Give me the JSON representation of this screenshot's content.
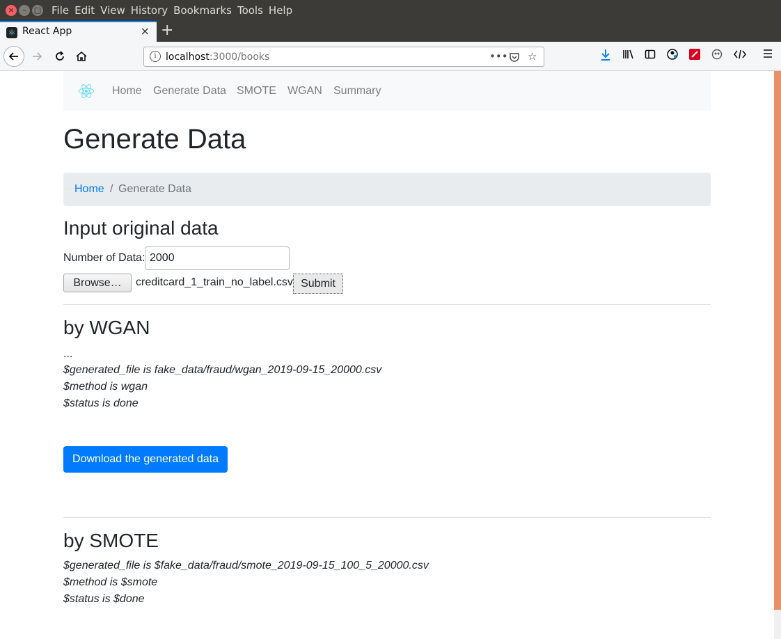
{
  "os_menu": [
    "File",
    "Edit",
    "View",
    "History",
    "Bookmarks",
    "Tools",
    "Help"
  ],
  "window_controls": {
    "close": "×",
    "minimize": "–",
    "maximize": "□"
  },
  "tab": {
    "title": "React App",
    "close": "×",
    "new_tab": "+"
  },
  "address": {
    "host": "localhost",
    "rest": ":3000/books",
    "more": "•••"
  },
  "toolbar_icons": [
    "download-icon",
    "library-icon",
    "sidebar-icon",
    "account-icon",
    "extension-icon",
    "mask-icon",
    "devtools-icon",
    "menu-icon"
  ],
  "site_nav": {
    "links": [
      "Home",
      "Generate Data",
      "SMOTE",
      "WGAN",
      "Summary"
    ]
  },
  "page": {
    "title": "Generate Data",
    "breadcrumb": {
      "home": "Home",
      "separator": "/",
      "current": "Generate Data"
    },
    "input_section": {
      "heading": "Input original data",
      "number_label": "Number of Data:",
      "number_value": "2000",
      "browse_label": "Browse…",
      "file_name": "creditcard_1_train_no_label.csv",
      "submit_label": "Submit"
    },
    "wgan": {
      "heading": "by WGAN",
      "ellipsis": "...",
      "lines": [
        "$generated_file is fake_data/fraud/wgan_2019-09-15_20000.csv",
        "$method is wgan",
        "$status is done"
      ],
      "download_label": "Download the generated data"
    },
    "smote": {
      "heading": "by SMOTE",
      "lines": [
        "$generated_file is $fake_data/fraud/smote_2019-09-15_100_5_20000.csv",
        "$method is $smote",
        "$status is $done"
      ]
    }
  },
  "colors": {
    "primary": "#007bff",
    "scroll_thumb": "#e9906a"
  }
}
